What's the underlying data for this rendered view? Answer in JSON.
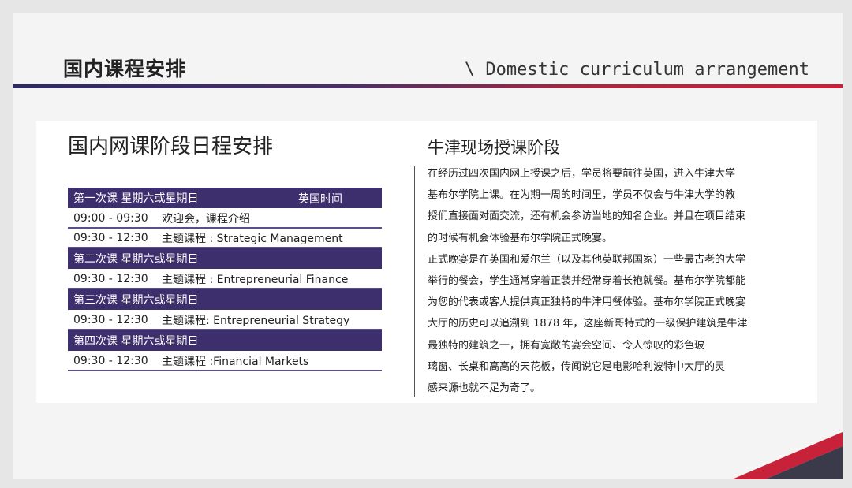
{
  "header": {
    "title": "国内课程安排",
    "subtitle": "\\ Domestic curriculum arrangement"
  },
  "left": {
    "title": "国内网课阶段日程安排",
    "timezone": "英国时间",
    "sessions": [
      {
        "heading": "第一次课 星期六或星期日",
        "rows": [
          {
            "time": "09:00 - 09:30",
            "topic": "欢迎会，课程介绍"
          },
          {
            "time": "09:30 - 12:30",
            "topic": "主题课程 : Strategic Management"
          }
        ]
      },
      {
        "heading": "第二次课 星期六或星期日",
        "rows": [
          {
            "time": "09:30 - 12:30",
            "topic": "主题课程 : Entrepreneurial Finance"
          }
        ]
      },
      {
        "heading": "第三次课 星期六或星期日",
        "rows": [
          {
            "time": "09:30 - 12:30",
            "topic": "主题课程: Entrepreneurial Strategy"
          }
        ]
      },
      {
        "heading": "第四次课 星期六或星期日",
        "rows": [
          {
            "time": "09:30 - 12:30",
            "topic": "主题课程 :Financial Markets"
          }
        ]
      }
    ]
  },
  "right": {
    "title": "牛津现场授课阶段",
    "lines": [
      "在经历过四次国内网上授课之后，学员将要前往英国，进入牛津大学",
      "基布尔学院上课。在为期一周的时间里，学员不仅会与牛津大学的教",
      "授们直接面对面交流，还有机会参访当地的知名企业。并且在项目结束",
      "的时候有机会体验基布尔学院正式晚宴。",
      "正式晚宴是在英国和爱尔兰（以及其他英联邦国家）一些最古老的大学",
      "举行的餐会，学生通常穿着正装并经常穿着长袍就餐。基布尔学院都能",
      "为您的代表或客人提供真正独特的牛津用餐体验。基布尔学院正式晚宴",
      "大厅的历史可以追溯到 1878 年，这座新哥特式的一级保护建筑是牛津",
      "最独特的建筑之一，拥有宽敞的宴会空间、令人惊叹的彩色玻",
      "璃窗、长桌和高高的天花板，传闻说它是电影哈利波特中大厅的灵",
      "感来源也就不足为奇了。"
    ]
  },
  "colors": {
    "header_bar": "#3d2f6e",
    "accent_red": "#c8213a",
    "accent_navy": "#2d2a66"
  }
}
